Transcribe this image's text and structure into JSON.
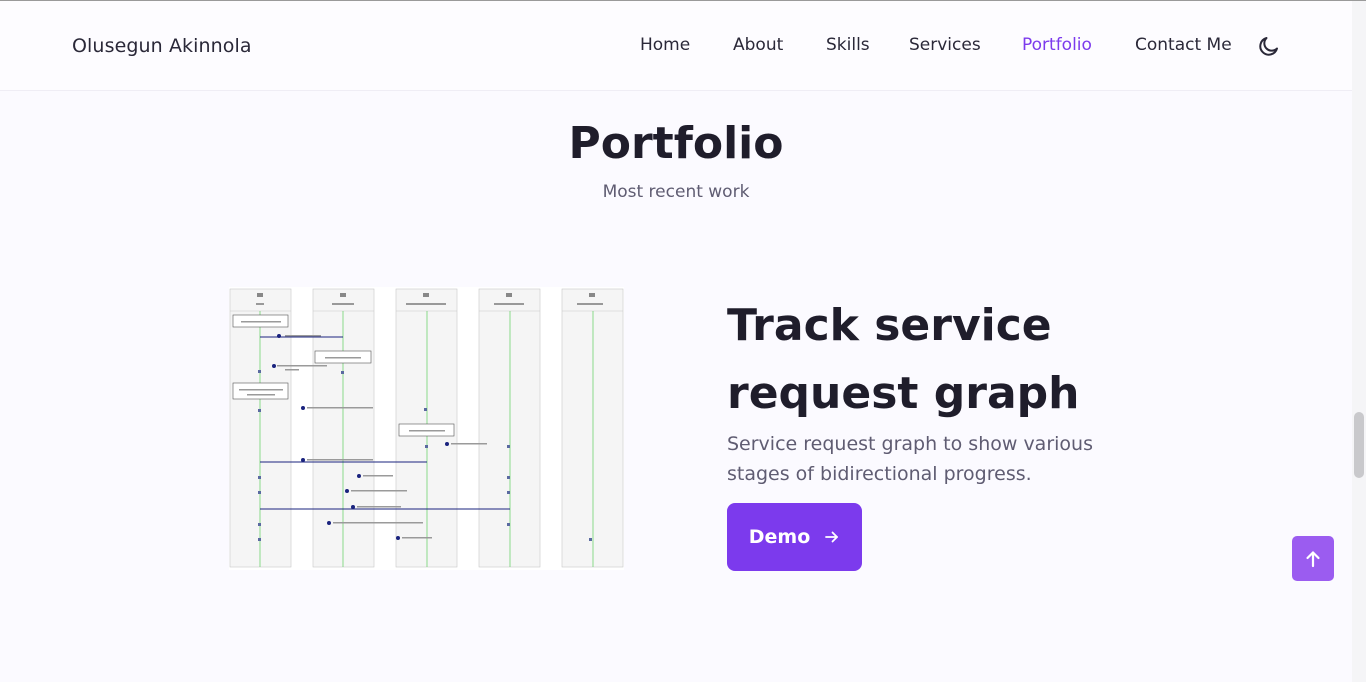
{
  "header": {
    "brand": "Olusegun Akinnola",
    "nav": [
      {
        "label": "Home",
        "active": false
      },
      {
        "label": "About",
        "active": false
      },
      {
        "label": "Skills",
        "active": false
      },
      {
        "label": "Services",
        "active": false
      },
      {
        "label": "Portfolio",
        "active": true
      },
      {
        "label": "Contact Me",
        "active": false
      }
    ],
    "theme_icon": "moon-icon"
  },
  "section": {
    "title": "Portfolio",
    "subtitle": "Most recent work"
  },
  "project": {
    "image_alt": "Sequence diagram screenshot",
    "title": "Track service request graph",
    "description": "Service request graph to show various stages of bidirectional progress.",
    "demo_label": "Demo",
    "demo_icon": "arrow-right-icon"
  },
  "scroll_up_icon": "arrow-up-icon",
  "colors": {
    "accent": "#7c3aed",
    "scroll_up_bg": "#9b5cf0",
    "text": "#1f1d2b",
    "muted": "#5f5c72"
  }
}
